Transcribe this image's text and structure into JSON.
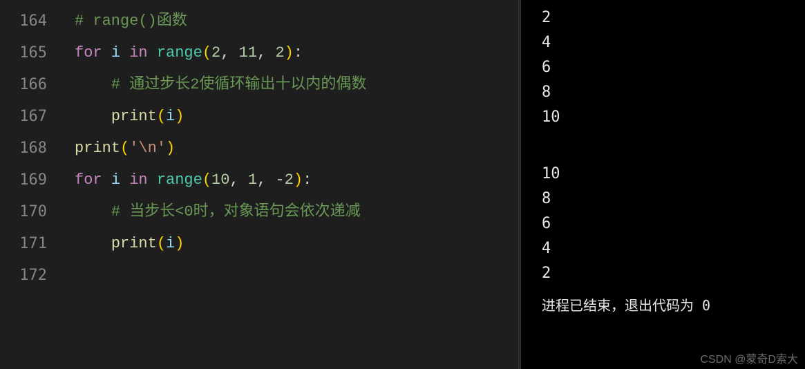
{
  "editor": {
    "line_numbers": [
      "164",
      "165",
      "166",
      "167",
      "168",
      "169",
      "170",
      "171",
      "172"
    ],
    "tokens": {
      "l164_comment": "# range()函数",
      "l165_for": "for",
      "l165_i": "i",
      "l165_in": "in",
      "l165_range": "range",
      "l165_lp": "(",
      "l165_n1": "2",
      "l165_c1": ", ",
      "l165_n2": "11",
      "l165_c2": ", ",
      "l165_n3": "2",
      "l165_rp": ")",
      "l165_colon": ":",
      "l166_comment": "# 通过步长2使循环输出十以内的偶数",
      "l167_print": "print",
      "l167_lp": "(",
      "l167_i": "i",
      "l167_rp": ")",
      "l168_print": "print",
      "l168_lp": "(",
      "l168_str": "'\\n'",
      "l168_rp": ")",
      "l169_for": "for",
      "l169_i": "i",
      "l169_in": "in",
      "l169_range": "range",
      "l169_lp": "(",
      "l169_n1": "10",
      "l169_c1": ", ",
      "l169_n2": "1",
      "l169_c2": ", ",
      "l169_neg": "-",
      "l169_n3": "2",
      "l169_rp": ")",
      "l169_colon": ":",
      "l170_comment": "# 当步长<0时，对象语句会依次递减",
      "l171_print": "print",
      "l171_lp": "(",
      "l171_i": "i",
      "l171_rp": ")"
    }
  },
  "terminal": {
    "output1": [
      "2",
      "4",
      "6",
      "8",
      "10"
    ],
    "output2": [
      "10",
      "8",
      "6",
      "4",
      "2"
    ],
    "status": "进程已结束，退出代码为  0"
  },
  "watermark": "CSDN @蒙奇D索大"
}
